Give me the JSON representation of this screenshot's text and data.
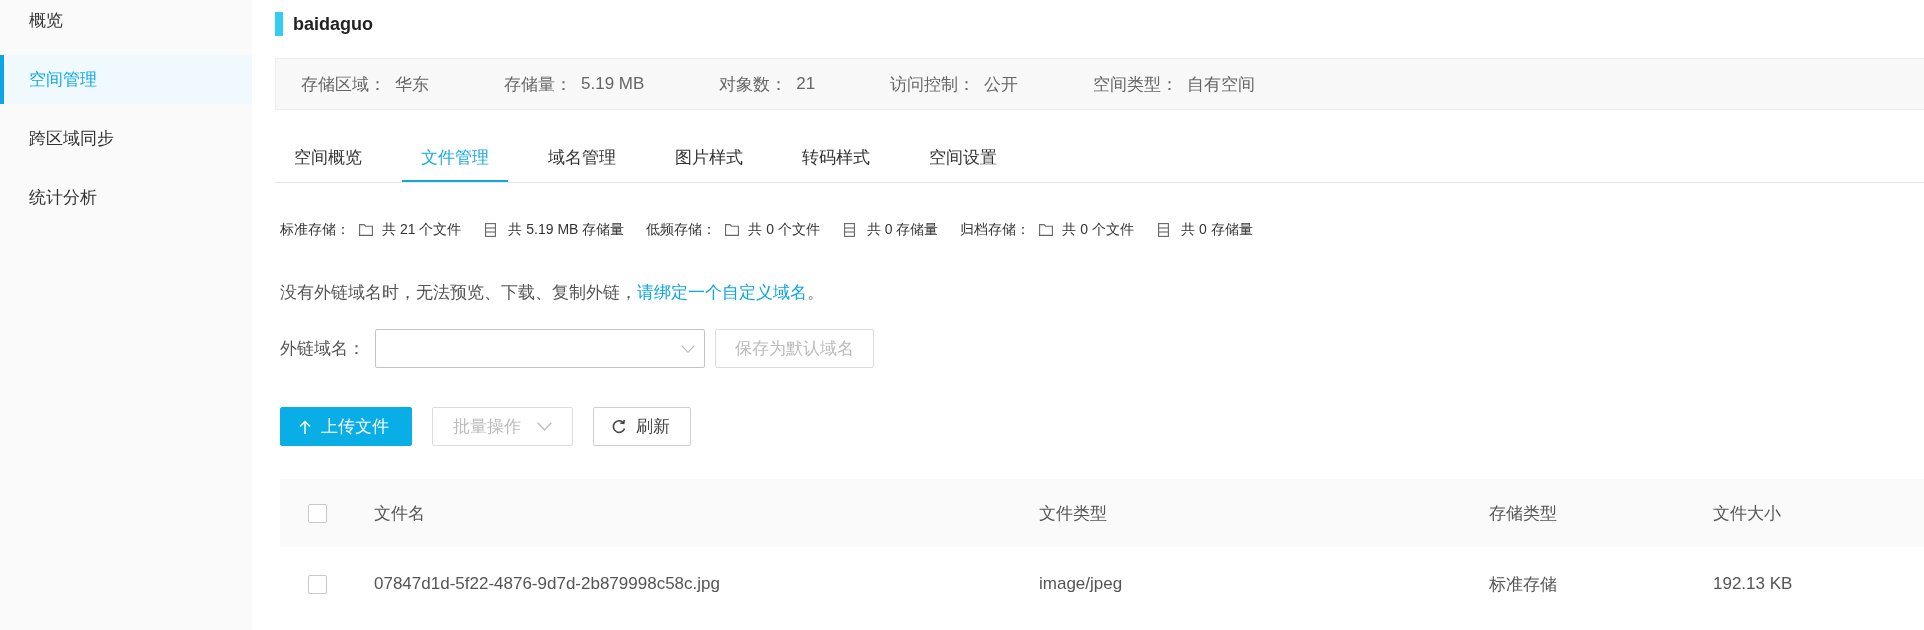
{
  "sidebar": {
    "items": [
      {
        "label": "概览",
        "selected": false
      },
      {
        "label": "空间管理",
        "selected": true
      },
      {
        "label": "跨区域同步",
        "selected": false
      },
      {
        "label": "统计分析",
        "selected": false
      }
    ]
  },
  "bucket": {
    "name": "baidaguo"
  },
  "info_bar": [
    {
      "label": "存储区域：",
      "value": "华东"
    },
    {
      "label": "存储量：",
      "value": "5.19 MB"
    },
    {
      "label": "对象数：",
      "value": "21"
    },
    {
      "label": "访问控制：",
      "value": "公开"
    },
    {
      "label": "空间类型：",
      "value": "自有空间"
    }
  ],
  "tabs": [
    {
      "label": "空间概览",
      "selected": false
    },
    {
      "label": "文件管理",
      "selected": true
    },
    {
      "label": "域名管理",
      "selected": false
    },
    {
      "label": "图片样式",
      "selected": false
    },
    {
      "label": "转码样式",
      "selected": false
    },
    {
      "label": "空间设置",
      "selected": false
    }
  ],
  "storage_stats": [
    {
      "label": "标准存储：",
      "files": "共 21 个文件",
      "size": "共 5.19 MB 存储量"
    },
    {
      "label": "低频存储：",
      "files": "共 0 个文件",
      "size": "共 0 存储量"
    },
    {
      "label": "归档存储：",
      "files": "共 0 个文件",
      "size": "共 0 存储量"
    }
  ],
  "notice": {
    "text": "没有外链域名时，无法预览、下载、复制外链，",
    "link": "请绑定一个自定义域名",
    "tail": "。"
  },
  "domain": {
    "label": "外链域名：",
    "save_button": {
      "label": "保存为默认域名",
      "disabled": true
    }
  },
  "toolbar": {
    "buttons": [
      {
        "kind": "upload",
        "label": "上传文件",
        "disabled": false
      },
      {
        "kind": "dropdown",
        "label": "批量操作",
        "disabled": true
      },
      {
        "kind": "refresh",
        "label": "刷新",
        "disabled": false
      }
    ]
  },
  "table": {
    "select_all_checked": false,
    "columns": [
      "文件名",
      "文件类型",
      "存储类型",
      "文件大小"
    ],
    "rows": [
      {
        "checked": false,
        "cells": [
          "07847d1d-5f22-4876-9d7d-2b879998c58c.jpg",
          "image/jpeg",
          "标准存储",
          "192.13 KB"
        ]
      }
    ]
  }
}
